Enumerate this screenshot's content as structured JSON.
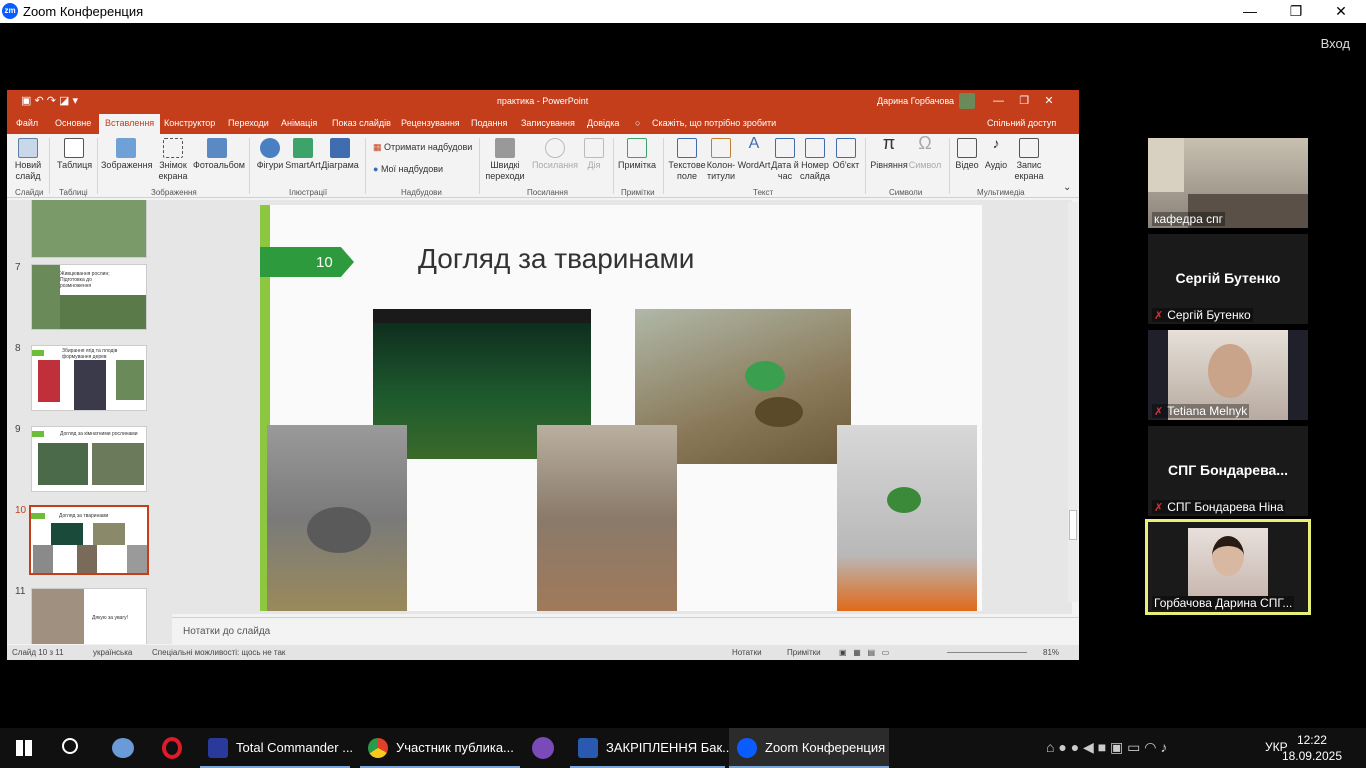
{
  "zoom": {
    "title": "Zoom Конференция",
    "exit": "Вход",
    "win_min": "—",
    "win_max": "❐",
    "win_close": "✕"
  },
  "ppt": {
    "doc_title": "практика - PowerPoint",
    "user": "Дарина Горбачова",
    "tabs": [
      "Файл",
      "Основне",
      "Вставлення",
      "Конструктор",
      "Переходи",
      "Анімація",
      "Показ слайдів",
      "Рецензування",
      "Подання",
      "Записування",
      "Довідка"
    ],
    "tell_me": "Скажіть, що потрібно зробити",
    "share": "Спільний доступ",
    "ribbon": {
      "new_slide": "Новий слайд",
      "table": "Таблиця",
      "images": "Зображення",
      "screenshot": "Знімок екрана",
      "album": "Фотоальбом",
      "shapes": "Фігури",
      "smartart": "SmartArt",
      "chart": "Діаграма",
      "get_addins": "Отримати надбудови",
      "my_addins": "Мої надбудови",
      "zoom": "Швидкі переходи",
      "link": "Посилання",
      "action": "Дія",
      "comment": "Примітка",
      "textbox": "Текстове поле",
      "header": "Колон-титули",
      "wordart": "WordArt",
      "datetime": "Дата й час",
      "slidenum": "Номер слайда",
      "object": "Об'єкт",
      "equation": "Рівняння",
      "symbol": "Символ",
      "video": "Відео",
      "audio": "Аудіо",
      "record": "Запис екрана",
      "groups": [
        "Слайди",
        "Таблиці",
        "Зображення",
        "Ілюстрації",
        "Надбудови",
        "Посилання",
        "Примітки",
        "Текст",
        "Символи",
        "Мультимедіа"
      ]
    },
    "thumbs": [
      {
        "num": "7",
        "text": "Живцювання рослин; Підготовка до розмноження"
      },
      {
        "num": "8",
        "text": "Збирання ягід та плодів формування дерев"
      },
      {
        "num": "9",
        "text": "Догляд за кімнатними рослинами"
      },
      {
        "num": "10",
        "text": "Догляд за тваринами"
      },
      {
        "num": "11",
        "text": "Дякую за увагу!"
      }
    ],
    "slide": {
      "number": "10",
      "title": "Догляд за тваринами"
    },
    "notes": "Нотатки до слайда",
    "status": {
      "slide": "Слайд 10 з 11",
      "lang": "українська",
      "access": "Спеціальні можливості: щось не так",
      "notes": "Нотатки",
      "comments": "Примітки",
      "zoom": "81%"
    }
  },
  "participants": [
    {
      "name": "кафедра спг",
      "type": "video"
    },
    {
      "name": "Сергій Бутенко",
      "big": "Сергій Бутенко",
      "type": "name"
    },
    {
      "name": "Tetiana Melnyk",
      "type": "video"
    },
    {
      "name": "СПГ Бондарева Ніна",
      "big": "СПГ  Бондарева...",
      "type": "name"
    },
    {
      "name": "Горбачова Дарина СПГ...",
      "type": "video"
    }
  ],
  "taskbar": {
    "apps": [
      "Total Commander ...",
      "Участник публика...",
      "ЗАКРІПЛЕННЯ Бак...",
      "Zoom Конференция"
    ],
    "lang": "УКР",
    "time": "12:22",
    "date": "18.09.2025"
  }
}
